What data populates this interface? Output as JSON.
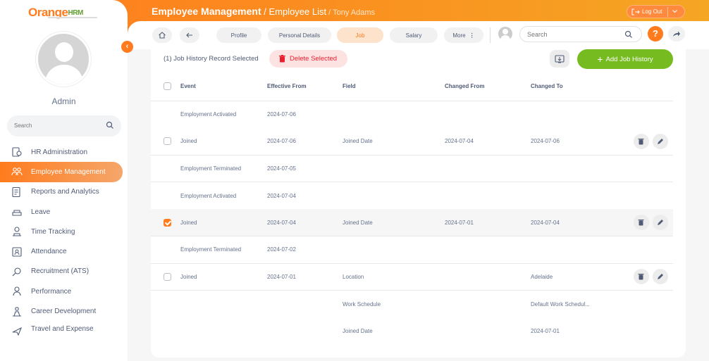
{
  "app": {
    "logo_main": "Orange",
    "logo_hrm": "HRM"
  },
  "user": {
    "name": "Admin"
  },
  "sidebar": {
    "search_placeholder": "Search",
    "items": [
      {
        "label": "HR Administration",
        "icon": "hr-admin-icon"
      },
      {
        "label": "Employee Management",
        "icon": "employee-mgmt-icon",
        "active": true
      },
      {
        "label": "Reports and Analytics",
        "icon": "reports-icon"
      },
      {
        "label": "Leave",
        "icon": "leave-icon"
      },
      {
        "label": "Time Tracking",
        "icon": "time-icon"
      },
      {
        "label": "Attendance",
        "icon": "attendance-icon"
      },
      {
        "label": "Recruitment (ATS)",
        "icon": "recruitment-icon"
      },
      {
        "label": "Performance",
        "icon": "performance-icon"
      },
      {
        "label": "Career Development",
        "icon": "career-icon"
      },
      {
        "label": "Travel and Expense",
        "icon": "travel-icon"
      }
    ]
  },
  "header": {
    "module": "Employee Management",
    "separator": " / ",
    "page": "Employee List",
    "employee": " / Tony Adams",
    "logout_label": "Log Out"
  },
  "tabs": {
    "profile": "Profile",
    "personal_details": "Personal Details",
    "job": "Job",
    "salary": "Salary",
    "more": "More",
    "search_placeholder": "Search",
    "help": "?"
  },
  "toolbar": {
    "selected_text": "(1) Job History Record Selected",
    "delete_label": "Delete Selected",
    "add_label": "Add Job History"
  },
  "table": {
    "headers": {
      "event": "Event",
      "effective_from": "Effective From",
      "field": "Field",
      "changed_from": "Changed From",
      "changed_to": "Changed To"
    },
    "rows": [
      {
        "event": "Employment Activated",
        "effective_from": "2024-07-06",
        "field": "",
        "changed_from": "",
        "changed_to": ""
      },
      {
        "event": "Joined",
        "effective_from": "2024-07-06",
        "field": "Joined Date",
        "changed_from": "2024-07-04",
        "changed_to": "2024-07-06"
      },
      {
        "event": "Employment Terminated",
        "effective_from": "2024-07-05",
        "field": "",
        "changed_from": "",
        "changed_to": ""
      },
      {
        "event": "Employment Activated",
        "effective_from": "2024-07-04",
        "field": "",
        "changed_from": "",
        "changed_to": ""
      },
      {
        "event": "Joined",
        "effective_from": "2024-07-04",
        "field": "Joined Date",
        "changed_from": "2024-07-01",
        "changed_to": "2024-07-04"
      },
      {
        "event": "Employment Terminated",
        "effective_from": "2024-07-02",
        "field": "",
        "changed_from": "",
        "changed_to": ""
      },
      {
        "event": "Joined",
        "effective_from": "2024-07-01",
        "field": "Location",
        "changed_from": "",
        "changed_to": "Adelaide"
      },
      {
        "event": "",
        "effective_from": "",
        "field": "Work Schedule",
        "changed_from": "",
        "changed_to": "Default Work Schedul..."
      },
      {
        "event": "",
        "effective_from": "",
        "field": "Joined Date",
        "changed_from": "",
        "changed_to": "2024-07-01"
      }
    ]
  },
  "colors": {
    "accent": "#ff7b1d",
    "green": "#76bc21",
    "danger": "#eb1e2d"
  }
}
